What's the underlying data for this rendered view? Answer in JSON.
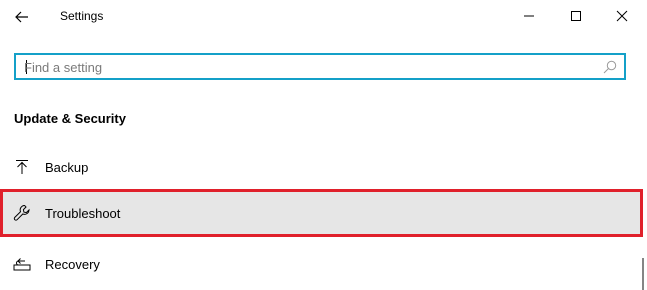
{
  "window": {
    "title": "Settings"
  },
  "titlebar": {
    "back_icon": "back-arrow-icon",
    "minimize_icon": "minimize-icon",
    "maximize_icon": "maximize-icon",
    "close_icon": "close-icon"
  },
  "search": {
    "placeholder": "Find a setting",
    "value": "",
    "icon": "search-icon",
    "border_color": "#14a0c8"
  },
  "section": {
    "heading": "Update & Security"
  },
  "nav": {
    "items": [
      {
        "label": "Backup",
        "icon": "backup-arrow-up-icon"
      },
      {
        "label": "Troubleshoot",
        "icon": "wrench-icon",
        "highlighted": true,
        "highlight_color": "#e0202b"
      },
      {
        "label": "Recovery",
        "icon": "recovery-icon"
      }
    ]
  }
}
